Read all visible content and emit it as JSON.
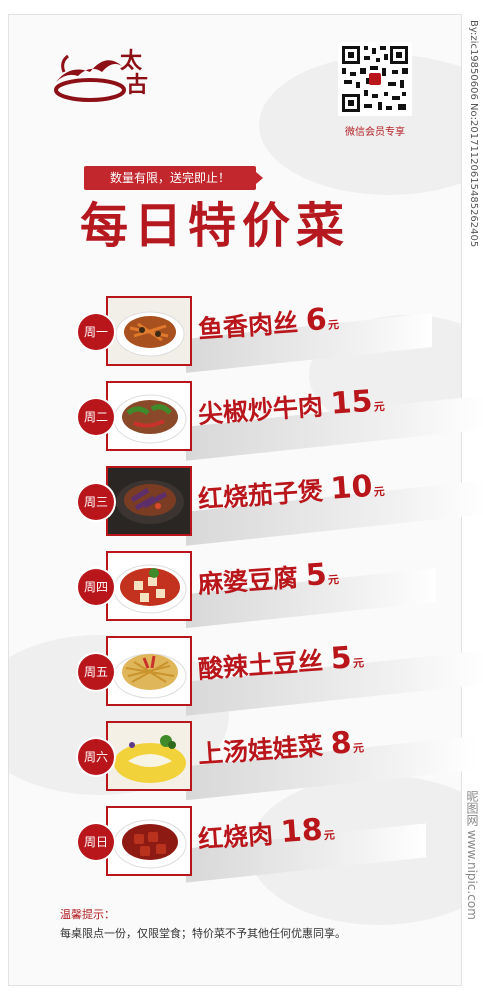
{
  "brand": {
    "name": "太古"
  },
  "qr": {
    "label": "微信会员专享"
  },
  "promo": {
    "tag": "数量有限，送完即止！",
    "title": "每日特价菜"
  },
  "menu": {
    "items": [
      {
        "day": "周一",
        "dish": "鱼香肉丝",
        "price": "6",
        "unit": "元"
      },
      {
        "day": "周二",
        "dish": "尖椒炒牛肉",
        "price": "15",
        "unit": "元"
      },
      {
        "day": "周三",
        "dish": "红烧茄子煲",
        "price": "10",
        "unit": "元"
      },
      {
        "day": "周四",
        "dish": "麻婆豆腐",
        "price": "5",
        "unit": "元"
      },
      {
        "day": "周五",
        "dish": "酸辣土豆丝",
        "price": "5",
        "unit": "元"
      },
      {
        "day": "周六",
        "dish": "上汤娃娃菜",
        "price": "8",
        "unit": "元"
      },
      {
        "day": "周日",
        "dish": "红烧肉",
        "price": "18",
        "unit": "元"
      }
    ]
  },
  "footer": {
    "tips_title": "温馨提示：",
    "note": "每桌限点一份，仅限堂食；特价菜不予其他任何优惠同享。"
  },
  "watermark": {
    "side_text": "By:zic19850606 No:20171120615485262405",
    "site": "昵图网 www.nipic.com"
  },
  "colors": {
    "accent": "#b9161c",
    "strip": "#d8d8d8"
  }
}
